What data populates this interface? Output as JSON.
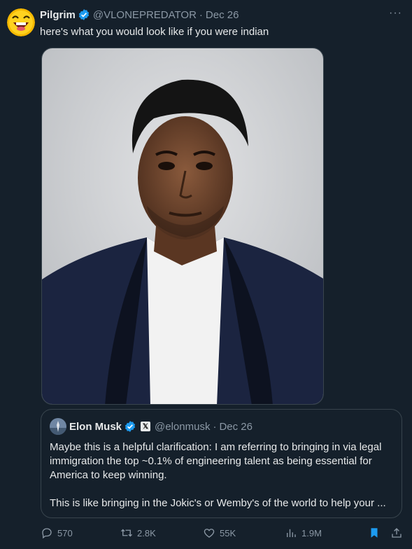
{
  "author": {
    "name": "Pilgrim",
    "handle": "@VLONEPREDATOR",
    "date": "Dec 26"
  },
  "tweet_text": "here's what you would look like if you were indian",
  "quote": {
    "name": "Elon Musk",
    "handle": "@elonmusk",
    "date": "Dec 26",
    "text_p1": "Maybe this is a helpful clarification: I am referring to bringing in via legal immigration the top ~0.1% of engineering talent as being essential for America to keep winning.",
    "text_p2": "This is like bringing in the Jokic's or Wemby's of the world to help your ..."
  },
  "actions": {
    "replies": "570",
    "reposts": "2.8K",
    "likes": "55K",
    "views": "1.9M"
  },
  "colors": {
    "background": "#15202b",
    "accent": "#1d9bf0",
    "muted": "#8b98a5",
    "border": "#38444d"
  },
  "icons": [
    "laughing-emoji-avatar",
    "verified-badge-icon",
    "more-icon",
    "x-logo-badge",
    "reply-icon",
    "repost-icon",
    "like-icon",
    "views-icon",
    "bookmark-icon",
    "share-icon"
  ]
}
